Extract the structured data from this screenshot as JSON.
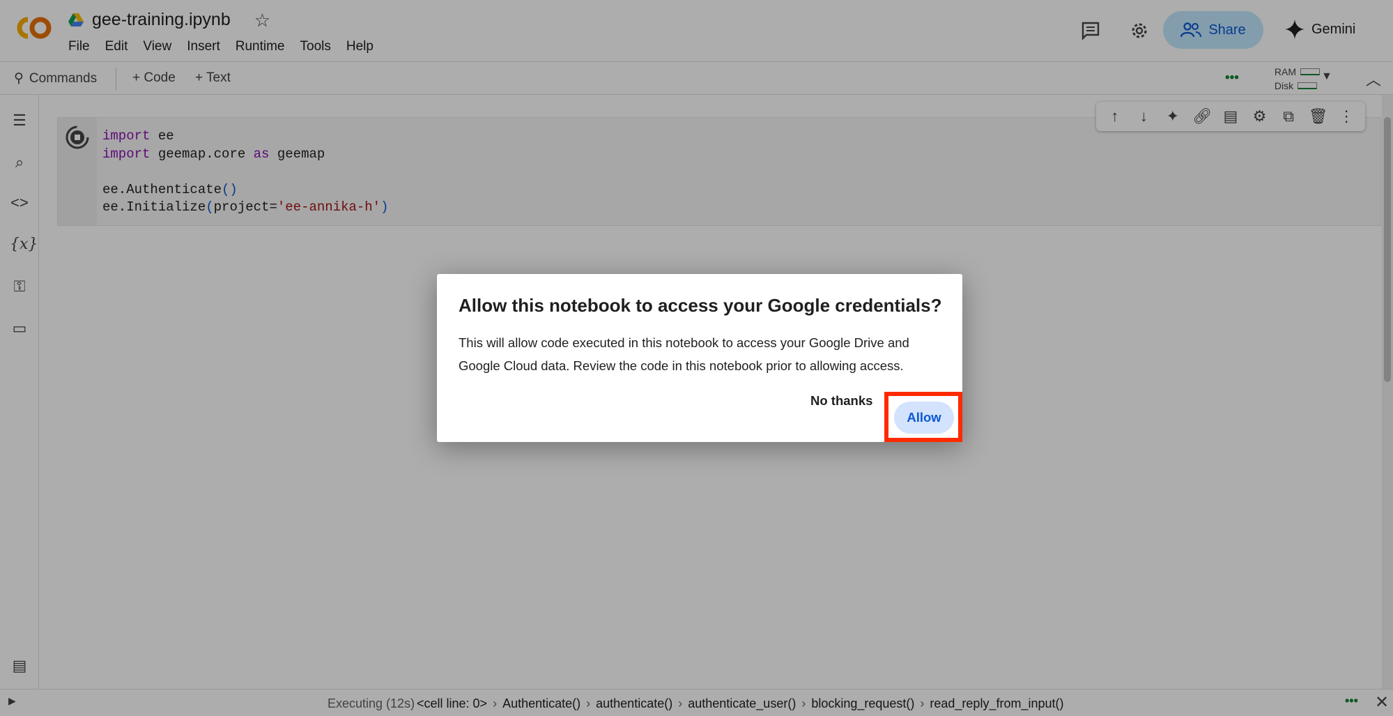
{
  "app": {
    "notebook_title": "gee-training.ipynb",
    "menu": [
      "File",
      "Edit",
      "View",
      "Insert",
      "Runtime",
      "Tools",
      "Help"
    ],
    "share_label": "Share",
    "gemini_label": "Gemini"
  },
  "toolbar": {
    "commands_label": "Commands",
    "add_code_label": "+ Code",
    "add_text_label": "+ Text",
    "ram_label": "RAM",
    "disk_label": "Disk"
  },
  "cell": {
    "lines": [
      {
        "kw": "import",
        "rest": " ee"
      },
      {
        "kw": "import",
        "rest": " geemap.core ",
        "kw2": "as",
        "rest2": " geemap"
      },
      {
        "text": ""
      },
      {
        "pre": "ee.Authenticate",
        "paren": "()"
      },
      {
        "pre": "ee.Initialize",
        "paren_open": "(",
        "arg": "project=",
        "str": "'ee-annika-h'",
        "paren_close": ")"
      }
    ]
  },
  "dialog": {
    "title": "Allow this notebook to access your Google credentials?",
    "body": "This will allow code executed in this notebook to access your Google Drive and Google Cloud data. Review the code in this notebook prior to allowing access.",
    "no_thanks_label": "No thanks",
    "allow_label": "Allow"
  },
  "status": {
    "executing": "Executing (12s)",
    "crumbs": [
      "<cell line: 0>",
      "Authenticate()",
      "authenticate()",
      "authenticate_user()",
      "blocking_request()",
      "read_reply_from_input()"
    ]
  },
  "colors": {
    "accent": "#0b57d0",
    "share_bg": "#c2e7ff",
    "highlight": "#ff2a00"
  }
}
